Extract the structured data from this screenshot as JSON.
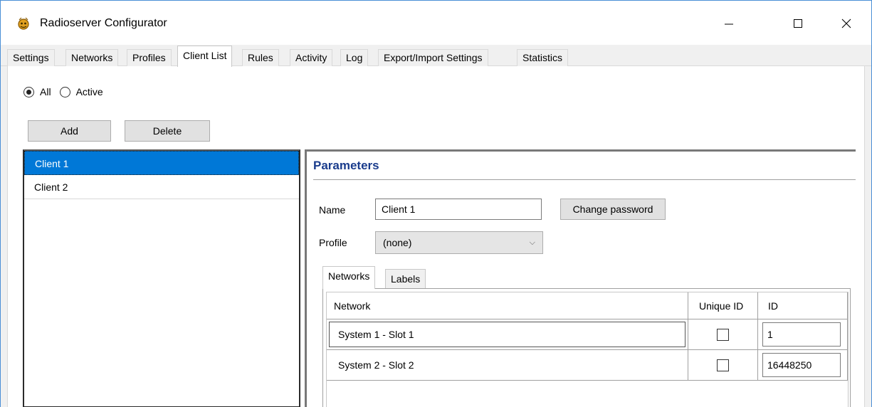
{
  "window": {
    "title": "Radioserver Configurator"
  },
  "tabs": [
    {
      "label": "Settings"
    },
    {
      "label": "Networks"
    },
    {
      "label": "Profiles"
    },
    {
      "label": "Client List",
      "active": true
    },
    {
      "label": "Rules"
    },
    {
      "label": "Activity"
    },
    {
      "label": "Log"
    },
    {
      "label": "Export/Import Settings"
    },
    {
      "label": "Statistics"
    }
  ],
  "filter": {
    "all_label": "All",
    "active_label": "Active",
    "selected": "All"
  },
  "buttons": {
    "add": "Add",
    "delete": "Delete"
  },
  "clients": [
    {
      "name": "Client 1",
      "selected": true
    },
    {
      "name": "Client 2",
      "selected": false
    }
  ],
  "parameters": {
    "title": "Parameters",
    "name_label": "Name",
    "name_value": "Client 1",
    "change_password": "Change password",
    "profile_label": "Profile",
    "profile_value": "(none)",
    "tabs": [
      {
        "label": "Networks",
        "active": true
      },
      {
        "label": "Labels"
      }
    ],
    "columns": {
      "network": "Network",
      "unique_id": "Unique ID",
      "id": "ID"
    },
    "rows": [
      {
        "network": "System 1 - Slot 1",
        "unique_id": false,
        "id": "1"
      },
      {
        "network": "System 2 - Slot 2",
        "unique_id": false,
        "id": "16448250"
      }
    ]
  },
  "colors": {
    "selection": "#0078d7",
    "title_blue": "#1a3c8c"
  }
}
